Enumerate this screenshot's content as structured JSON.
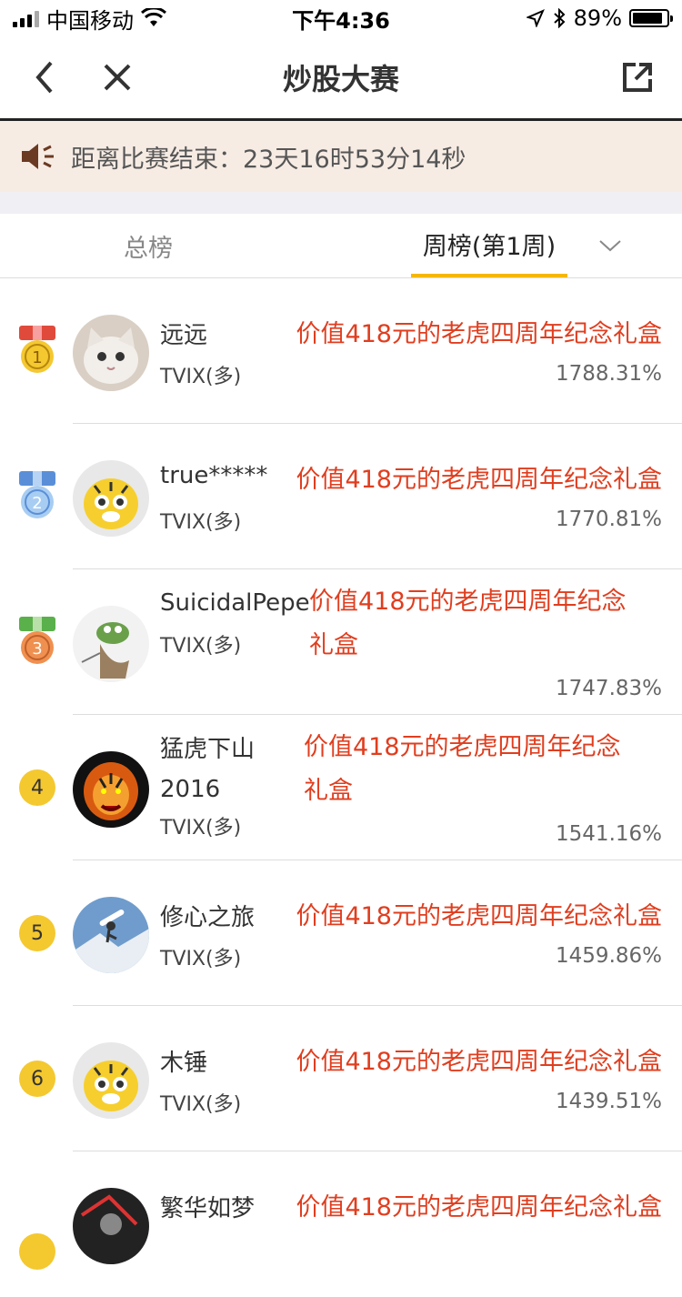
{
  "status_bar": {
    "carrier": "中国移动",
    "time": "下午4:36",
    "battery_pct": "89%",
    "battery_level": 0.89
  },
  "nav": {
    "title": "炒股大赛",
    "back_icon": "chevron-left-icon",
    "close_icon": "close-icon",
    "share_icon": "share-external-icon"
  },
  "countdown": {
    "icon": "speaker-icon",
    "text": "距离比赛结束：23天16时53分14秒"
  },
  "tabs": {
    "total": "总榜",
    "week": "周榜(第1周)",
    "dropdown_icon": "chevron-down-icon"
  },
  "colors": {
    "accent": "#f5b800",
    "prize": "#e03e1f",
    "gold": "#f4c82f",
    "silver": "#8ab8e8",
    "bronze": "#f09050"
  },
  "entries": [
    {
      "rank": "1",
      "medal": "gold",
      "name": "远远",
      "side": "TVIX(多)",
      "prize": "价值418元的老虎四周年纪念礼盒",
      "pct": "1788.31%",
      "avatar": "cat-avatar"
    },
    {
      "rank": "2",
      "medal": "silver",
      "name": "true*****",
      "side": "TVIX(多)",
      "prize": "价值418元的老虎四周年纪念礼盒",
      "pct": "1770.81%",
      "avatar": "tiger-cartoon-avatar"
    },
    {
      "rank": "3",
      "medal": "bronze",
      "name": "SuicidalPepe",
      "side": "TVIX(多)",
      "prize_line1": "价值418元的老虎四周年纪念",
      "prize_line2": "礼盒",
      "pct": "1747.83%",
      "avatar": "pepe-frog-avatar"
    },
    {
      "rank": "4",
      "medal": "none",
      "name_line1": "猛虎下山",
      "name_line2": "2016",
      "side": "TVIX(多)",
      "prize_line1": "价值418元的老虎四周年纪念",
      "prize_line2": "礼盒",
      "pct": "1541.16%",
      "avatar": "fire-tiger-avatar"
    },
    {
      "rank": "5",
      "medal": "none",
      "name": "修心之旅",
      "side": "TVIX(多)",
      "prize": "价值418元的老虎四周年纪念礼盒",
      "pct": "1459.86%",
      "avatar": "snowboard-avatar"
    },
    {
      "rank": "6",
      "medal": "none",
      "name": "木锤",
      "side": "TVIX(多)",
      "prize": "价值418元的老虎四周年纪念礼盒",
      "pct": "1439.51%",
      "avatar": "tiger-cartoon-avatar"
    },
    {
      "name": "繁华如梦",
      "prize": "价值418元的老虎四周年纪念礼盒",
      "avatar": "dark-avatar"
    }
  ]
}
